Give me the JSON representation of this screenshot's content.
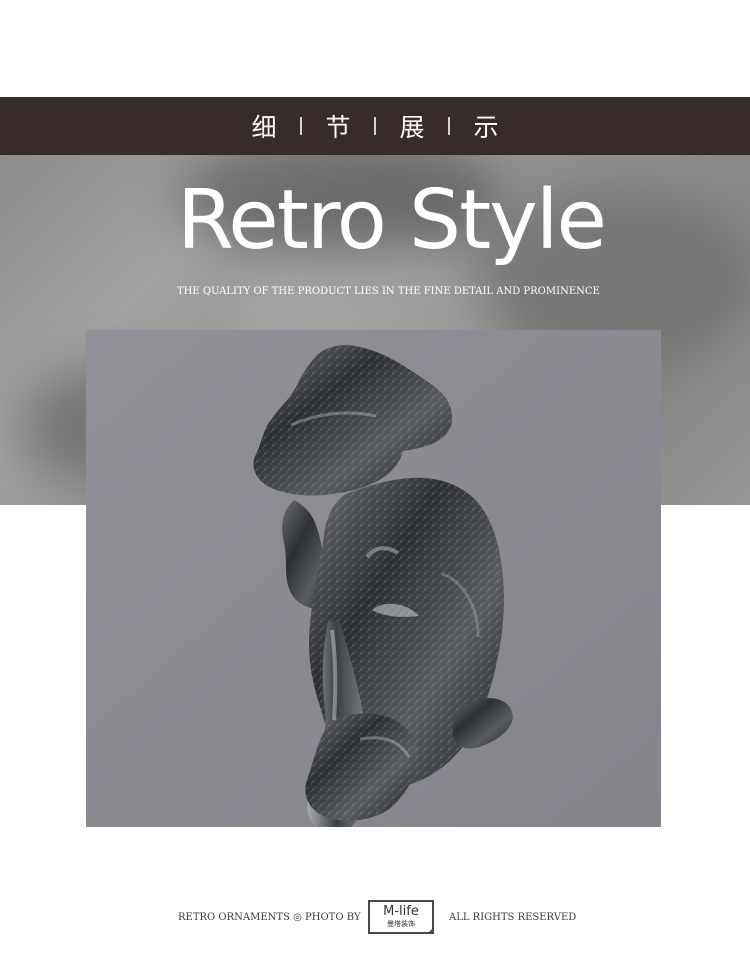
{
  "header": {
    "chars": [
      "细",
      "节",
      "展",
      "示"
    ]
  },
  "hero": {
    "title": "Retro Style",
    "subtitle": "THE QUALITY OF THE PRODUCT LIES IN THE FINE DETAIL AND PROMINENCE"
  },
  "photo": {
    "subject": "silent thinker sculpture"
  },
  "footer": {
    "left": "RETRO ORNAMENTS ◎ PHOTO BY",
    "logo_main": "M-life",
    "logo_sub": "曼塔装饰",
    "right": "ALL RIGHTS RESERVED"
  },
  "colors": {
    "header_bg": "#372c2a",
    "photo_bg": "#8c8a91",
    "text_dark": "#3b3b3b"
  }
}
